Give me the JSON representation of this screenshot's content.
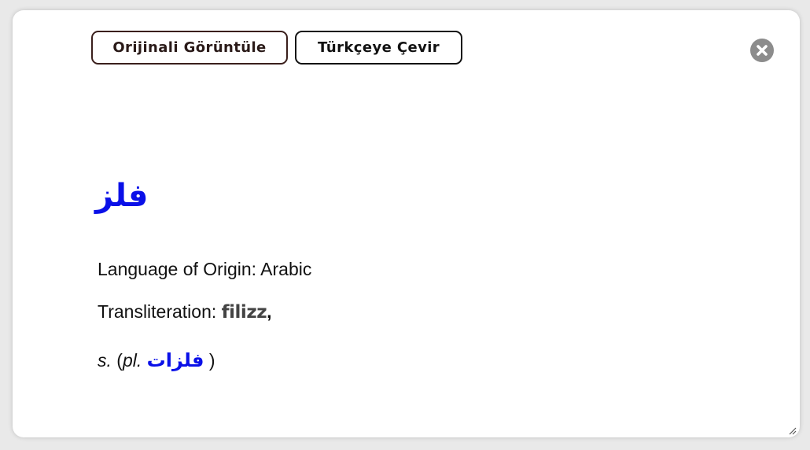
{
  "toolbar": {
    "original_label": "Orijinali Görüntüle",
    "translate_label": "Türkçeye Çevir"
  },
  "close_icon": "close-circle-icon",
  "entry": {
    "headword": "فلز",
    "origin_label": "Language of Origin:",
    "origin_value": "Arabic",
    "translit_label": "Transliteration:",
    "translit_value": "filizz",
    "translit_sep": ",",
    "pos": "s.",
    "plural_open": "(",
    "plural_label": "pl.",
    "plural_value": "فلزات",
    "plural_close": ")"
  },
  "colors": {
    "accent_blue": "#0a10e8",
    "button_border_brown": "#3a1f1c",
    "close_gray": "#8c8c8c"
  }
}
